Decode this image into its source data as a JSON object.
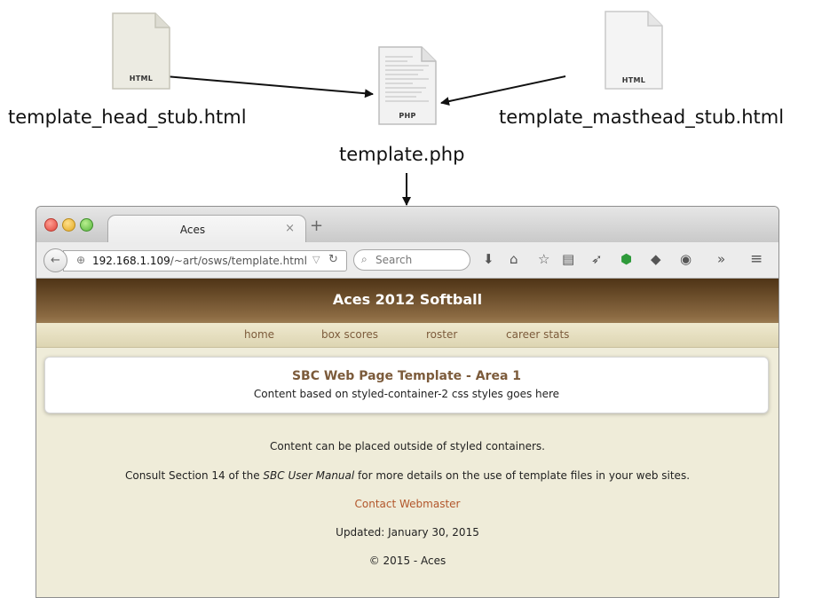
{
  "diagram": {
    "files": [
      {
        "tag": "HTML",
        "name": "template_head_stub.html"
      },
      {
        "tag": "PHP",
        "name": "template.php"
      },
      {
        "tag": "HTML",
        "name": "template_masthead_stub.html"
      }
    ]
  },
  "browser": {
    "tab_title": "Aces",
    "tab_close": "×",
    "new_tab": "+",
    "url_host": "192.168.1.109",
    "url_path": "/~art/osws/template.html",
    "search_placeholder": "Search",
    "masthead_title": "Aces 2012 Softball",
    "menu": [
      "home",
      "box scores",
      "roster",
      "career stats"
    ],
    "container": {
      "title": "SBC Web Page Template - Area 1",
      "text": "Content based on styled-container-2 css styles goes here"
    },
    "content": {
      "line1": "Content can be placed outside of styled containers.",
      "line2_pre": "Consult Section 14 of the ",
      "line2_em": "SBC User Manual",
      "line2_post": " for more details on the use of template files in your web sites.",
      "contact": "Contact Webmaster",
      "updated": "Updated: January 30, 2015",
      "copyright": "© 2015 - Aces"
    }
  },
  "icons": [
    "back-arrow-icon",
    "globe-icon",
    "reload-icon",
    "search-icon",
    "download-icon",
    "home-icon",
    "star-icon",
    "reading-list-icon",
    "send-icon",
    "extension-icon",
    "pocket-icon",
    "history-icon",
    "overflow-icon",
    "menu-icon"
  ]
}
